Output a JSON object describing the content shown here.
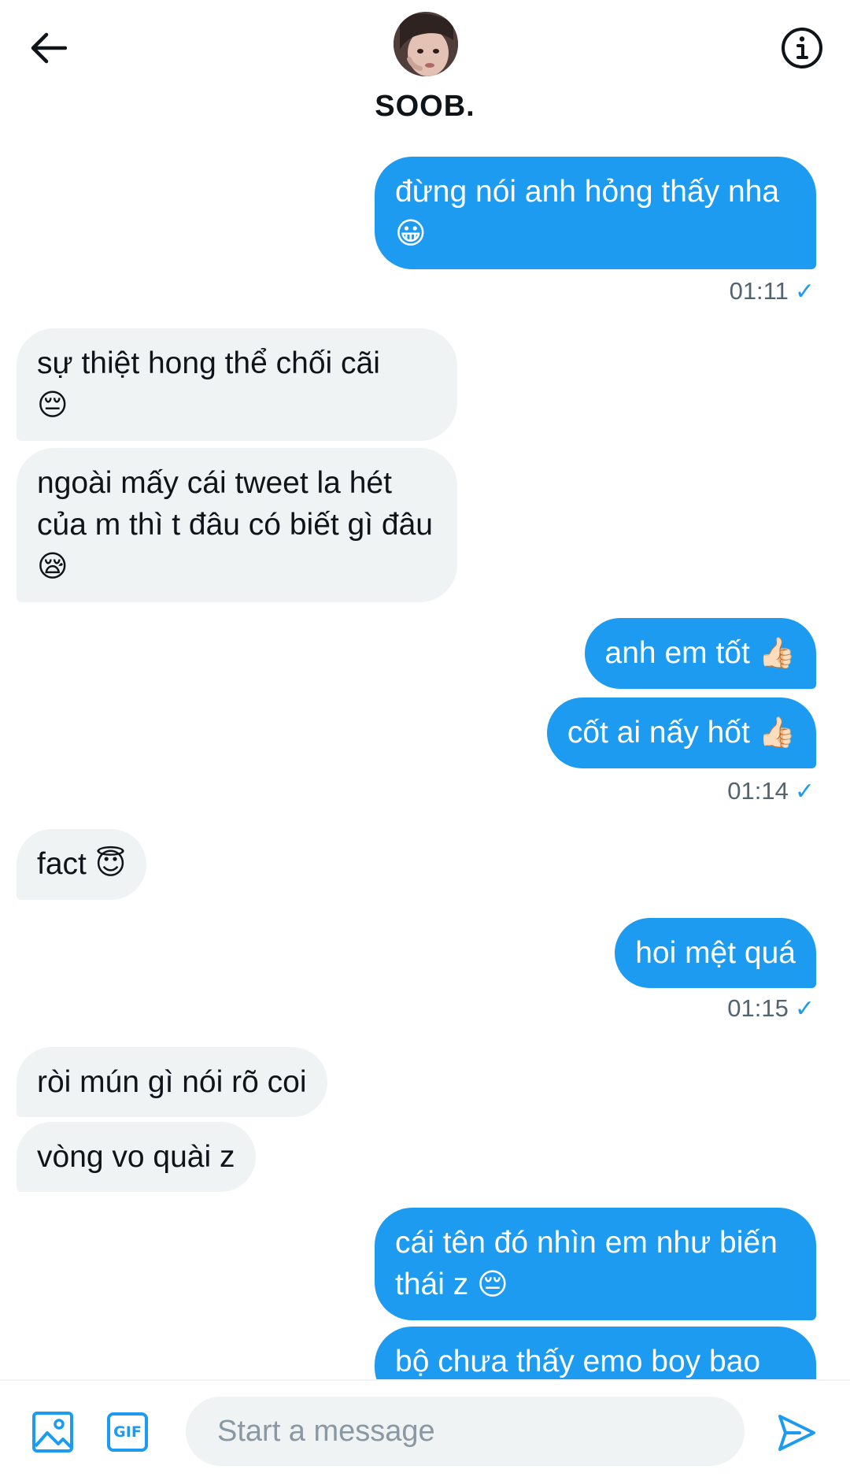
{
  "header": {
    "contact_name": "SOOB.",
    "back_icon": "arrow-left-icon",
    "info_icon": "info-icon"
  },
  "messages": [
    {
      "side": "sent",
      "text": "đừng nói anh hỏng thấy nha",
      "emoji": "😀"
    },
    {
      "side": "sent-meta",
      "time": "01:11",
      "status_icon": "check-icon"
    },
    {
      "side": "received",
      "text": "sự thiệt hong thể chối cãi",
      "emoji": "😔"
    },
    {
      "side": "received",
      "text": "ngoài mấy cái tweet la hét của m thì t đâu có biết gì đâu",
      "emoji": "😪"
    },
    {
      "side": "sent",
      "text": "anh em tốt",
      "emoji": "👍🏻"
    },
    {
      "side": "sent",
      "text": "cốt ai nấy hốt",
      "emoji": "👍🏻"
    },
    {
      "side": "sent-meta",
      "time": "01:14",
      "status_icon": "check-icon"
    },
    {
      "side": "received",
      "text": "fact",
      "emoji": "😇"
    },
    {
      "side": "sent",
      "text": "hoi mệt quá",
      "emoji": ""
    },
    {
      "side": "sent-meta",
      "time": "01:15",
      "status_icon": "check-icon"
    },
    {
      "side": "received",
      "text": "ròi mún gì nói rõ coi",
      "emoji": ""
    },
    {
      "side": "received",
      "text": "vòng vo quài z",
      "emoji": ""
    },
    {
      "side": "sent",
      "text": "cái tên đó nhìn em như biến thái z",
      "emoji": "😔"
    },
    {
      "side": "sent",
      "text": "bộ chưa thấy emo boy bao",
      "emoji": ""
    }
  ],
  "composer": {
    "media_icon": "image-icon",
    "gif_label": "GIF",
    "placeholder": "Start a message",
    "send_icon": "send-icon"
  },
  "colors": {
    "accent": "#1d9bf0",
    "received_bubble": "#eff3f4",
    "meta_text": "#536471"
  }
}
